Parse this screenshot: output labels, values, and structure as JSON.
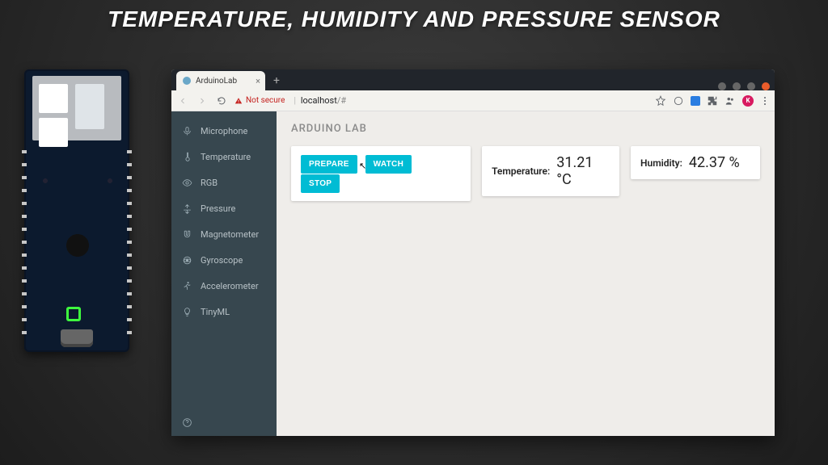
{
  "slide": {
    "title": "TEMPERATURE, HUMIDITY AND PRESSURE SENSOR"
  },
  "browser": {
    "tab_title": "ArduinoLab",
    "not_secure": "Not secure",
    "url_host": "localhost",
    "url_path": "/#",
    "avatar_letter": "K"
  },
  "app": {
    "title": "ARDUINO LAB",
    "sidebar": {
      "items": [
        {
          "label": "Microphone",
          "icon": "mic-icon"
        },
        {
          "label": "Temperature",
          "icon": "thermometer-icon"
        },
        {
          "label": "RGB",
          "icon": "eye-icon"
        },
        {
          "label": "Pressure",
          "icon": "pressure-icon"
        },
        {
          "label": "Magnetometer",
          "icon": "magnet-icon"
        },
        {
          "label": "Gyroscope",
          "icon": "gyroscope-icon"
        },
        {
          "label": "Accelerometer",
          "icon": "run-icon"
        },
        {
          "label": "TinyML",
          "icon": "bulb-icon"
        }
      ]
    },
    "actions": {
      "prepare": "PREPARE",
      "watch": "WATCH",
      "stop": "STOP"
    },
    "readings": {
      "temperature_label": "Temperature:",
      "temperature_value": "31.21 °C",
      "humidity_label": "Humidity:",
      "humidity_value": "42.37 %"
    }
  }
}
